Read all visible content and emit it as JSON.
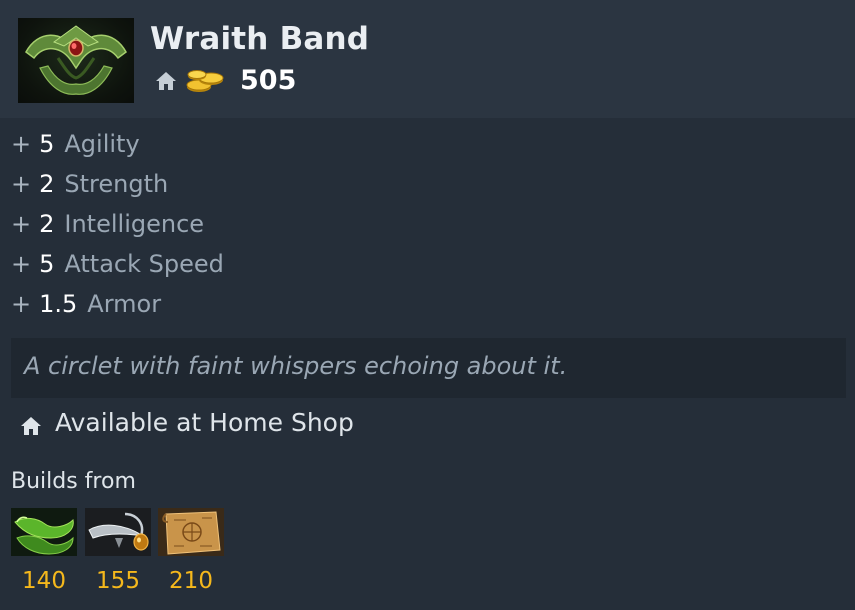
{
  "item": {
    "name": "Wraith Band",
    "icon": "wraith-band-item-icon",
    "cost": "505",
    "cost_icons": [
      "home-shop-icon",
      "gold-coins-icon"
    ]
  },
  "stats": [
    {
      "plus": "+",
      "value": "5",
      "name": "Agility"
    },
    {
      "plus": "+",
      "value": "2",
      "name": "Strength"
    },
    {
      "plus": "+",
      "value": "2",
      "name": "Intelligence"
    },
    {
      "plus": "+",
      "value": "5",
      "name": "Attack Speed"
    },
    {
      "plus": "+",
      "value": "1.5",
      "name": "Armor"
    }
  ],
  "lore": "A circlet with faint whispers echoing about it.",
  "availability": {
    "icon": "home-shop-icon",
    "text": "Available at Home Shop"
  },
  "builds": {
    "label": "Builds from",
    "components": [
      {
        "icon": "slippers-of-agility-icon",
        "cost": "140"
      },
      {
        "icon": "circlet-icon",
        "cost": "155"
      },
      {
        "icon": "recipe-scroll-icon",
        "cost": "210"
      }
    ]
  },
  "colors": {
    "background": "#252e39",
    "header": "#2b3541",
    "lore_background": "#1f2730",
    "gold": "#f5b81c",
    "value_white": "#ffffff",
    "stat_label": "#9aa7b4"
  }
}
